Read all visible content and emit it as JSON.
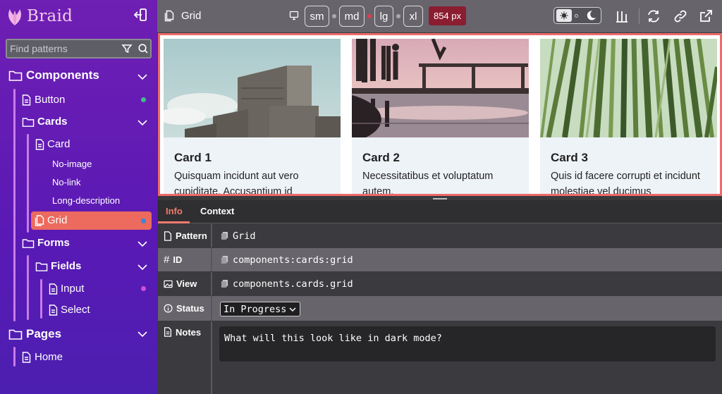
{
  "brand": {
    "name": "Braid"
  },
  "search": {
    "placeholder": "Find patterns"
  },
  "nav": {
    "components": "Components",
    "button": "Button",
    "cards": "Cards",
    "card": "Card",
    "no_image": "No-image",
    "no_link": "No-link",
    "long_description": "Long-description",
    "grid": "Grid",
    "forms": "Forms",
    "fields": "Fields",
    "input": "Input",
    "select": "Select",
    "pages": "Pages",
    "home": "Home"
  },
  "toolbar": {
    "title": "Grid",
    "breakpoints": [
      "sm",
      "md",
      "lg",
      "xl"
    ],
    "width_badge": "854 px"
  },
  "preview": {
    "cards": [
      {
        "title": "Card 1",
        "description": "Quisquam incidunt aut vero cupiditate. Accusantium id"
      },
      {
        "title": "Card 2",
        "description": "Necessitatibus et voluptatum autem."
      },
      {
        "title": "Card 3",
        "description": "Quis id facere corrupti et incidunt molestiae vel ducimus"
      }
    ]
  },
  "panel": {
    "tabs": {
      "info": "Info",
      "context": "Context"
    },
    "rows": {
      "pattern": {
        "key": "Pattern",
        "value": "Grid"
      },
      "id": {
        "key": "ID",
        "value": "components:cards:grid"
      },
      "view": {
        "key": "View",
        "value": "components.cards.grid"
      },
      "status": {
        "key": "Status",
        "value": "In Progress"
      },
      "notes": {
        "key": "Notes",
        "value": "What will this look like in dark mode?"
      }
    }
  },
  "colors": {
    "sidebar_top": "#6f1fb3",
    "accent_active": "#ec6a5e",
    "preview_border": "#ef6a6a",
    "badge": "#8b1d30",
    "tab_active": "#f07b6d"
  }
}
